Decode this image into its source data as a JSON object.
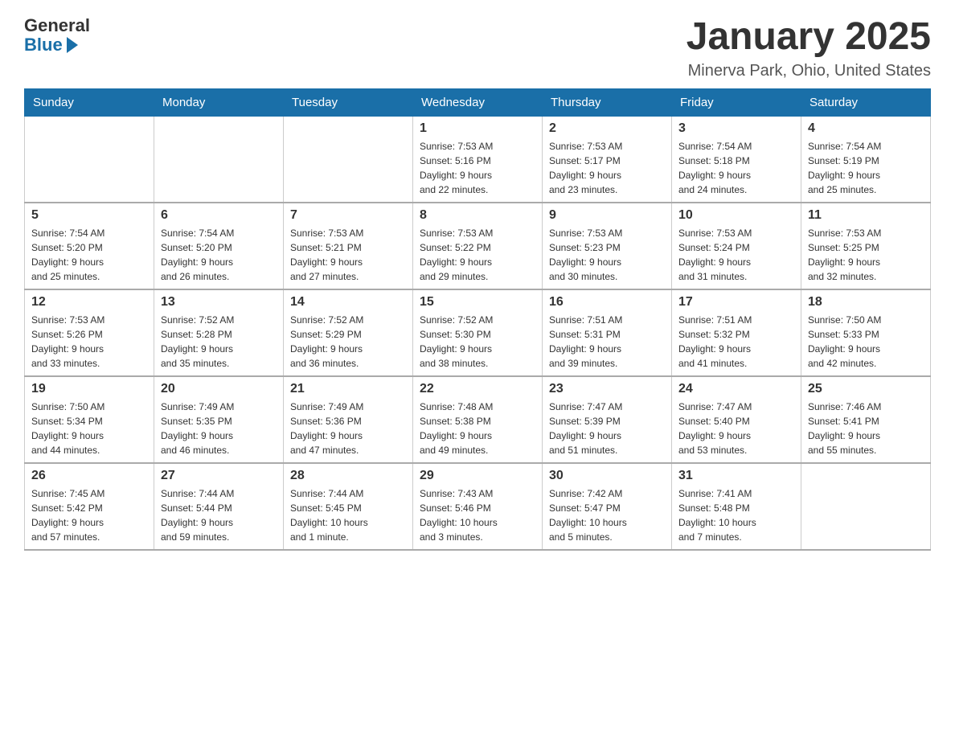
{
  "header": {
    "logo": {
      "general": "General",
      "arrow": "▶",
      "blue": "Blue"
    },
    "title": "January 2025",
    "subtitle": "Minerva Park, Ohio, United States"
  },
  "days_of_week": [
    "Sunday",
    "Monday",
    "Tuesday",
    "Wednesday",
    "Thursday",
    "Friday",
    "Saturday"
  ],
  "weeks": [
    [
      {
        "day": "",
        "info": ""
      },
      {
        "day": "",
        "info": ""
      },
      {
        "day": "",
        "info": ""
      },
      {
        "day": "1",
        "info": "Sunrise: 7:53 AM\nSunset: 5:16 PM\nDaylight: 9 hours\nand 22 minutes."
      },
      {
        "day": "2",
        "info": "Sunrise: 7:53 AM\nSunset: 5:17 PM\nDaylight: 9 hours\nand 23 minutes."
      },
      {
        "day": "3",
        "info": "Sunrise: 7:54 AM\nSunset: 5:18 PM\nDaylight: 9 hours\nand 24 minutes."
      },
      {
        "day": "4",
        "info": "Sunrise: 7:54 AM\nSunset: 5:19 PM\nDaylight: 9 hours\nand 25 minutes."
      }
    ],
    [
      {
        "day": "5",
        "info": "Sunrise: 7:54 AM\nSunset: 5:20 PM\nDaylight: 9 hours\nand 25 minutes."
      },
      {
        "day": "6",
        "info": "Sunrise: 7:54 AM\nSunset: 5:20 PM\nDaylight: 9 hours\nand 26 minutes."
      },
      {
        "day": "7",
        "info": "Sunrise: 7:53 AM\nSunset: 5:21 PM\nDaylight: 9 hours\nand 27 minutes."
      },
      {
        "day": "8",
        "info": "Sunrise: 7:53 AM\nSunset: 5:22 PM\nDaylight: 9 hours\nand 29 minutes."
      },
      {
        "day": "9",
        "info": "Sunrise: 7:53 AM\nSunset: 5:23 PM\nDaylight: 9 hours\nand 30 minutes."
      },
      {
        "day": "10",
        "info": "Sunrise: 7:53 AM\nSunset: 5:24 PM\nDaylight: 9 hours\nand 31 minutes."
      },
      {
        "day": "11",
        "info": "Sunrise: 7:53 AM\nSunset: 5:25 PM\nDaylight: 9 hours\nand 32 minutes."
      }
    ],
    [
      {
        "day": "12",
        "info": "Sunrise: 7:53 AM\nSunset: 5:26 PM\nDaylight: 9 hours\nand 33 minutes."
      },
      {
        "day": "13",
        "info": "Sunrise: 7:52 AM\nSunset: 5:28 PM\nDaylight: 9 hours\nand 35 minutes."
      },
      {
        "day": "14",
        "info": "Sunrise: 7:52 AM\nSunset: 5:29 PM\nDaylight: 9 hours\nand 36 minutes."
      },
      {
        "day": "15",
        "info": "Sunrise: 7:52 AM\nSunset: 5:30 PM\nDaylight: 9 hours\nand 38 minutes."
      },
      {
        "day": "16",
        "info": "Sunrise: 7:51 AM\nSunset: 5:31 PM\nDaylight: 9 hours\nand 39 minutes."
      },
      {
        "day": "17",
        "info": "Sunrise: 7:51 AM\nSunset: 5:32 PM\nDaylight: 9 hours\nand 41 minutes."
      },
      {
        "day": "18",
        "info": "Sunrise: 7:50 AM\nSunset: 5:33 PM\nDaylight: 9 hours\nand 42 minutes."
      }
    ],
    [
      {
        "day": "19",
        "info": "Sunrise: 7:50 AM\nSunset: 5:34 PM\nDaylight: 9 hours\nand 44 minutes."
      },
      {
        "day": "20",
        "info": "Sunrise: 7:49 AM\nSunset: 5:35 PM\nDaylight: 9 hours\nand 46 minutes."
      },
      {
        "day": "21",
        "info": "Sunrise: 7:49 AM\nSunset: 5:36 PM\nDaylight: 9 hours\nand 47 minutes."
      },
      {
        "day": "22",
        "info": "Sunrise: 7:48 AM\nSunset: 5:38 PM\nDaylight: 9 hours\nand 49 minutes."
      },
      {
        "day": "23",
        "info": "Sunrise: 7:47 AM\nSunset: 5:39 PM\nDaylight: 9 hours\nand 51 minutes."
      },
      {
        "day": "24",
        "info": "Sunrise: 7:47 AM\nSunset: 5:40 PM\nDaylight: 9 hours\nand 53 minutes."
      },
      {
        "day": "25",
        "info": "Sunrise: 7:46 AM\nSunset: 5:41 PM\nDaylight: 9 hours\nand 55 minutes."
      }
    ],
    [
      {
        "day": "26",
        "info": "Sunrise: 7:45 AM\nSunset: 5:42 PM\nDaylight: 9 hours\nand 57 minutes."
      },
      {
        "day": "27",
        "info": "Sunrise: 7:44 AM\nSunset: 5:44 PM\nDaylight: 9 hours\nand 59 minutes."
      },
      {
        "day": "28",
        "info": "Sunrise: 7:44 AM\nSunset: 5:45 PM\nDaylight: 10 hours\nand 1 minute."
      },
      {
        "day": "29",
        "info": "Sunrise: 7:43 AM\nSunset: 5:46 PM\nDaylight: 10 hours\nand 3 minutes."
      },
      {
        "day": "30",
        "info": "Sunrise: 7:42 AM\nSunset: 5:47 PM\nDaylight: 10 hours\nand 5 minutes."
      },
      {
        "day": "31",
        "info": "Sunrise: 7:41 AM\nSunset: 5:48 PM\nDaylight: 10 hours\nand 7 minutes."
      },
      {
        "day": "",
        "info": ""
      }
    ]
  ]
}
